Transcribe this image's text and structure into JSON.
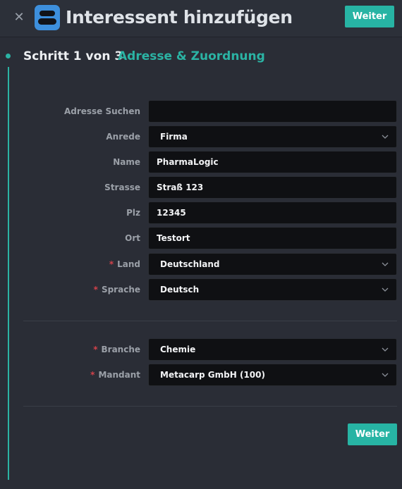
{
  "header": {
    "close_icon": "close-icon",
    "app_icon": "contacts-icon",
    "title": "Interessent hinzufügen",
    "next_button": "Weiter"
  },
  "step": {
    "counter": "Schritt 1 von 3",
    "name": "Adresse & Zuordnung"
  },
  "form": {
    "address_search": {
      "label": "Adresse Suchen",
      "value": ""
    },
    "salutation": {
      "label": "Anrede",
      "value": "Firma"
    },
    "name": {
      "label": "Name",
      "value": "PharmaLogic"
    },
    "street": {
      "label": "Strasse",
      "value": "Straß 123"
    },
    "zip": {
      "label": "Plz",
      "value": "12345"
    },
    "city": {
      "label": "Ort",
      "value": "Testort"
    },
    "country": {
      "label": "Land",
      "value": "Deutschland",
      "required_mark": "*"
    },
    "language": {
      "label": "Sprache",
      "value": "Deutsch",
      "required_mark": "*"
    },
    "industry": {
      "label": "Branche",
      "value": "Chemie",
      "required_mark": "*"
    },
    "client": {
      "label": "Mandant",
      "value": "Metacarp GmbH (100)",
      "required_mark": "*"
    }
  },
  "footer": {
    "next_button": "Weiter"
  },
  "colors": {
    "accent": "#27b4a4",
    "background": "#2a2d36",
    "field": "#0f1013",
    "required": "#d2424b",
    "icon": "#3d8fdc"
  }
}
